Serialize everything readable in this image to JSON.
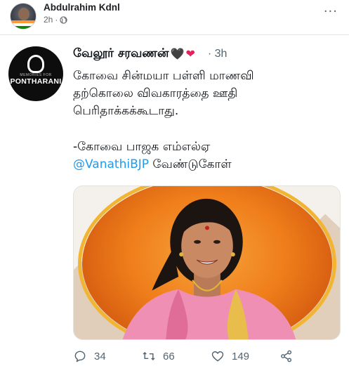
{
  "post": {
    "author": "Abdulrahim Kdnl",
    "time": "2h",
    "time_separator": "·",
    "more_label": "···"
  },
  "tweet": {
    "display_name": "வேலூர் சரவணன்",
    "heart1": "🖤",
    "heart2": "❤",
    "time": "· 3h",
    "avatar_text": "PONTHARANI",
    "avatar_small_text": "MEMORIES FOR",
    "body_lines": [
      "கோவை சின்மயா பள்ளி மாணவி",
      "தற்கொலை விவகாரத்தை ஊதி",
      "பெரிதாக்கக்கூடாது."
    ],
    "body_line4": "-கோவை பாஜக எம்எல்ஏ",
    "mention": "@VanathiBJP",
    "mention_suffix": " வேண்டுகோள்",
    "counts": {
      "replies": "34",
      "retweets": "66",
      "likes": "149"
    }
  },
  "colors": {
    "link": "#1d9bf0",
    "heart_red": "#e0245e",
    "image_orange": "#ef7d1a",
    "image_gold": "#f2b531",
    "saree_pink": "#f08fb4"
  },
  "icons": {
    "globe": "globe-icon",
    "more": "more-icon",
    "reply": "reply-icon",
    "retweet": "retweet-icon",
    "like": "like-icon",
    "share": "share-icon"
  }
}
